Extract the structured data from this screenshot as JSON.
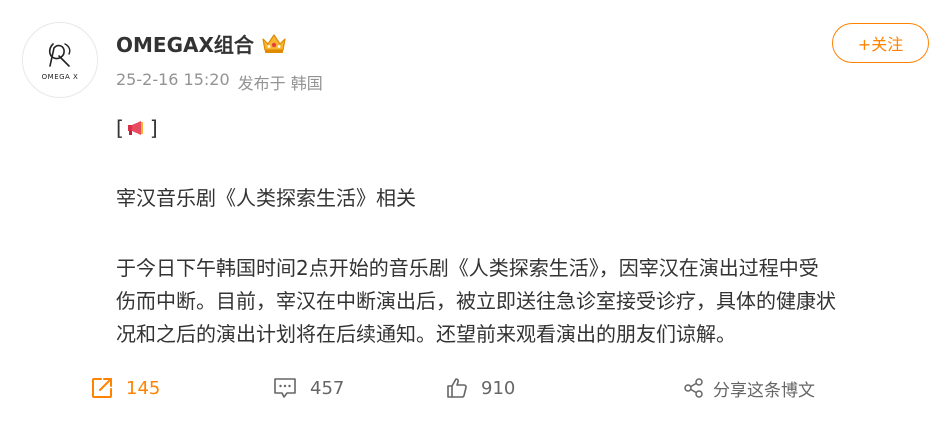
{
  "author": {
    "name": "OMEGAX组合",
    "avatar_text": "OMEGA X"
  },
  "meta": {
    "time": "25-2-16 15:20",
    "source": "发布于 韩国"
  },
  "follow_label": "+关注",
  "content": {
    "bracket_open": "[",
    "bracket_close": "]",
    "headline": "宰汉音乐剧《人类探索生活》相关",
    "body_lines": [
      "于今日下午韩国时间2点开始的音乐剧《人类探索生活》，因宰汉在演出过程中受",
      "伤而中断。目前，宰汉在中断演出后，被立即送往急诊室接受诊疗，具体的健康状",
      "况和之后的演出计划将在后续通知。还望前来观看演出的朋友们谅解。"
    ]
  },
  "actions": {
    "repost_count": "145",
    "comment_count": "457",
    "like_count": "910",
    "share_label": "分享这条博文"
  },
  "colors": {
    "accent": "#ff8200",
    "muted": "#939393",
    "text": "#333333"
  },
  "icons": {
    "repost": "repost-icon",
    "comment": "comment-icon",
    "like": "thumbs-up-icon",
    "share": "share-icon",
    "badge": "crown-icon",
    "megaphone": "megaphone-icon"
  }
}
